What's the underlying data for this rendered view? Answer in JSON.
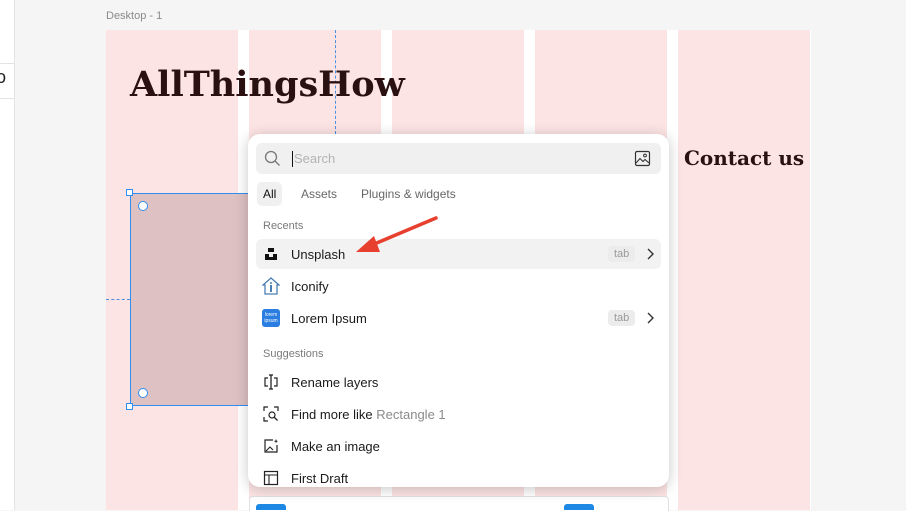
{
  "canvas": {
    "frame_label": "Desktop - 1",
    "title": "AllThingsHow",
    "contact": "Contact us"
  },
  "panel": {
    "search_placeholder": "Search",
    "tabs": [
      "All",
      "Assets",
      "Plugins & widgets"
    ],
    "sections": {
      "recents": "Recents",
      "suggestions": "Suggestions"
    },
    "recents": [
      {
        "label": "Unsplash",
        "badge": "tab",
        "icon": "unsplash-icon"
      },
      {
        "label": "Iconify",
        "icon": "iconify-icon"
      },
      {
        "label": "Lorem Ipsum",
        "badge": "tab",
        "icon": "lorem-ipsum-icon",
        "icon_text": [
          "lorem",
          "ipsum"
        ]
      }
    ],
    "suggestions": [
      {
        "label": "Rename layers",
        "icon": "rename-layers-icon"
      },
      {
        "label": "Find more like",
        "suffix": "Rectangle 1",
        "icon": "find-more-icon"
      },
      {
        "label": "Make an image",
        "icon": "make-image-icon"
      },
      {
        "label": "First Draft",
        "icon": "first-draft-icon"
      }
    ]
  },
  "colors": {
    "accent": "#2f8ff0",
    "column": "#fde4e4",
    "rect": "#dec1c3",
    "arrow": "#e8402e"
  }
}
